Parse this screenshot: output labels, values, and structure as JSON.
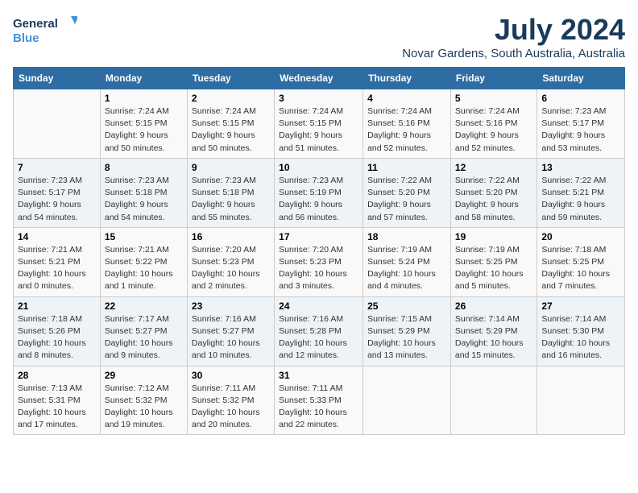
{
  "header": {
    "logo_line1": "General",
    "logo_line2": "Blue",
    "month_year": "July 2024",
    "location": "Novar Gardens, South Australia, Australia"
  },
  "days_of_week": [
    "Sunday",
    "Monday",
    "Tuesday",
    "Wednesday",
    "Thursday",
    "Friday",
    "Saturday"
  ],
  "weeks": [
    [
      {
        "num": "",
        "info": ""
      },
      {
        "num": "1",
        "info": "Sunrise: 7:24 AM\nSunset: 5:15 PM\nDaylight: 9 hours\nand 50 minutes."
      },
      {
        "num": "2",
        "info": "Sunrise: 7:24 AM\nSunset: 5:15 PM\nDaylight: 9 hours\nand 50 minutes."
      },
      {
        "num": "3",
        "info": "Sunrise: 7:24 AM\nSunset: 5:15 PM\nDaylight: 9 hours\nand 51 minutes."
      },
      {
        "num": "4",
        "info": "Sunrise: 7:24 AM\nSunset: 5:16 PM\nDaylight: 9 hours\nand 52 minutes."
      },
      {
        "num": "5",
        "info": "Sunrise: 7:24 AM\nSunset: 5:16 PM\nDaylight: 9 hours\nand 52 minutes."
      },
      {
        "num": "6",
        "info": "Sunrise: 7:23 AM\nSunset: 5:17 PM\nDaylight: 9 hours\nand 53 minutes."
      }
    ],
    [
      {
        "num": "7",
        "info": "Sunrise: 7:23 AM\nSunset: 5:17 PM\nDaylight: 9 hours\nand 54 minutes."
      },
      {
        "num": "8",
        "info": "Sunrise: 7:23 AM\nSunset: 5:18 PM\nDaylight: 9 hours\nand 54 minutes."
      },
      {
        "num": "9",
        "info": "Sunrise: 7:23 AM\nSunset: 5:18 PM\nDaylight: 9 hours\nand 55 minutes."
      },
      {
        "num": "10",
        "info": "Sunrise: 7:23 AM\nSunset: 5:19 PM\nDaylight: 9 hours\nand 56 minutes."
      },
      {
        "num": "11",
        "info": "Sunrise: 7:22 AM\nSunset: 5:20 PM\nDaylight: 9 hours\nand 57 minutes."
      },
      {
        "num": "12",
        "info": "Sunrise: 7:22 AM\nSunset: 5:20 PM\nDaylight: 9 hours\nand 58 minutes."
      },
      {
        "num": "13",
        "info": "Sunrise: 7:22 AM\nSunset: 5:21 PM\nDaylight: 9 hours\nand 59 minutes."
      }
    ],
    [
      {
        "num": "14",
        "info": "Sunrise: 7:21 AM\nSunset: 5:21 PM\nDaylight: 10 hours\nand 0 minutes."
      },
      {
        "num": "15",
        "info": "Sunrise: 7:21 AM\nSunset: 5:22 PM\nDaylight: 10 hours\nand 1 minute."
      },
      {
        "num": "16",
        "info": "Sunrise: 7:20 AM\nSunset: 5:23 PM\nDaylight: 10 hours\nand 2 minutes."
      },
      {
        "num": "17",
        "info": "Sunrise: 7:20 AM\nSunset: 5:23 PM\nDaylight: 10 hours\nand 3 minutes."
      },
      {
        "num": "18",
        "info": "Sunrise: 7:19 AM\nSunset: 5:24 PM\nDaylight: 10 hours\nand 4 minutes."
      },
      {
        "num": "19",
        "info": "Sunrise: 7:19 AM\nSunset: 5:25 PM\nDaylight: 10 hours\nand 5 minutes."
      },
      {
        "num": "20",
        "info": "Sunrise: 7:18 AM\nSunset: 5:25 PM\nDaylight: 10 hours\nand 7 minutes."
      }
    ],
    [
      {
        "num": "21",
        "info": "Sunrise: 7:18 AM\nSunset: 5:26 PM\nDaylight: 10 hours\nand 8 minutes."
      },
      {
        "num": "22",
        "info": "Sunrise: 7:17 AM\nSunset: 5:27 PM\nDaylight: 10 hours\nand 9 minutes."
      },
      {
        "num": "23",
        "info": "Sunrise: 7:16 AM\nSunset: 5:27 PM\nDaylight: 10 hours\nand 10 minutes."
      },
      {
        "num": "24",
        "info": "Sunrise: 7:16 AM\nSunset: 5:28 PM\nDaylight: 10 hours\nand 12 minutes."
      },
      {
        "num": "25",
        "info": "Sunrise: 7:15 AM\nSunset: 5:29 PM\nDaylight: 10 hours\nand 13 minutes."
      },
      {
        "num": "26",
        "info": "Sunrise: 7:14 AM\nSunset: 5:29 PM\nDaylight: 10 hours\nand 15 minutes."
      },
      {
        "num": "27",
        "info": "Sunrise: 7:14 AM\nSunset: 5:30 PM\nDaylight: 10 hours\nand 16 minutes."
      }
    ],
    [
      {
        "num": "28",
        "info": "Sunrise: 7:13 AM\nSunset: 5:31 PM\nDaylight: 10 hours\nand 17 minutes."
      },
      {
        "num": "29",
        "info": "Sunrise: 7:12 AM\nSunset: 5:32 PM\nDaylight: 10 hours\nand 19 minutes."
      },
      {
        "num": "30",
        "info": "Sunrise: 7:11 AM\nSunset: 5:32 PM\nDaylight: 10 hours\nand 20 minutes."
      },
      {
        "num": "31",
        "info": "Sunrise: 7:11 AM\nSunset: 5:33 PM\nDaylight: 10 hours\nand 22 minutes."
      },
      {
        "num": "",
        "info": ""
      },
      {
        "num": "",
        "info": ""
      },
      {
        "num": "",
        "info": ""
      }
    ]
  ]
}
